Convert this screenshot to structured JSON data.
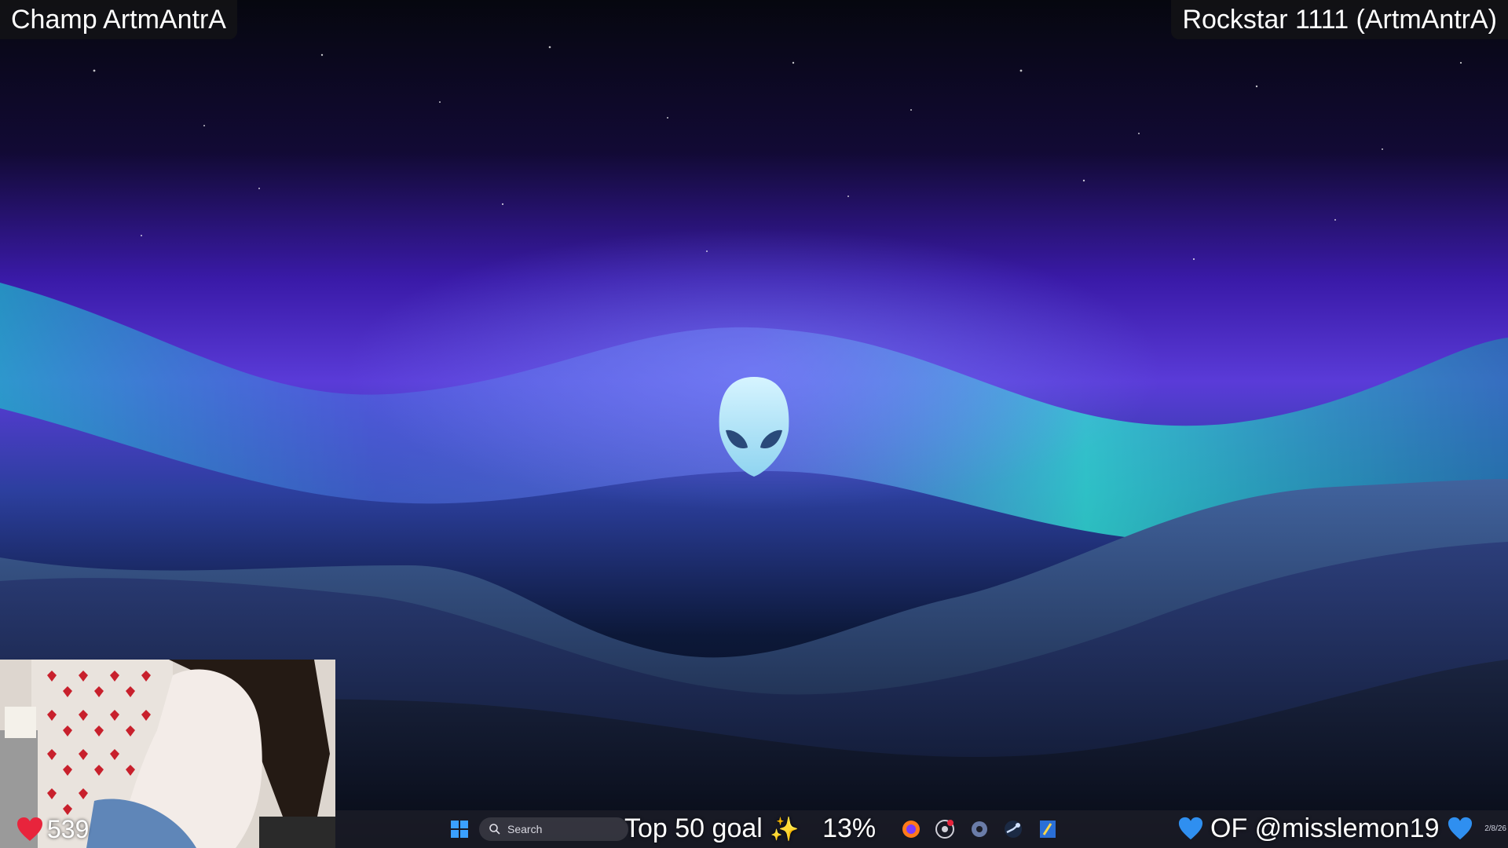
{
  "overlay": {
    "top_left_label": "Champ ArtmAntrA",
    "top_right_label": "Rockstar 1111 (ArtmAntrA)",
    "likes_count": "539",
    "goal_text": "Top 50 goal",
    "goal_percent": "13%",
    "social_handle": "OF @misslemon19"
  },
  "taskbar": {
    "search_placeholder": "Search",
    "clock_fragment": "2/8/26",
    "pinned_apps": [
      "start-icon",
      "search-icon",
      "firefox-icon",
      "chrome-icon",
      "settings-icon",
      "steam-icon",
      "app-icon"
    ]
  },
  "icons": {
    "heart": "heart-icon",
    "blue_heart": "blue-heart-icon",
    "sparkle": "sparkle-icon",
    "wallpaper_logo": "alien-head-logo"
  },
  "colors": {
    "aurora_teal": "#2fe0d0",
    "aurora_purple": "#5a2bd8",
    "heart_red": "#e8243c",
    "heart_blue": "#2f8ff0",
    "sparkle_yellow": "#ffd84a"
  }
}
